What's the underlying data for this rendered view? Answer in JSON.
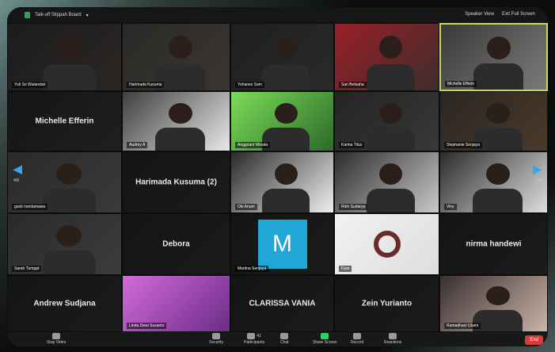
{
  "window": {
    "top_left_title": "Talk-off Slippah Board",
    "speaker_view": "Speaker View",
    "exit_full_screen": "Exit Full Screen"
  },
  "pager": {
    "left_label": "4/8",
    "right_label": "1/8"
  },
  "participants": [
    {
      "id": "tile-1",
      "name": "Yuli Sri Wulandari",
      "kind": "video"
    },
    {
      "id": "tile-2",
      "name": "Harimada Kusuma",
      "kind": "video"
    },
    {
      "id": "tile-3",
      "name": "Yohanes Sam",
      "kind": "video"
    },
    {
      "id": "tile-4",
      "name": "Sari Betsaha",
      "kind": "video"
    },
    {
      "id": "tile-5",
      "name": "Michelle Efferin",
      "kind": "video",
      "active": true
    },
    {
      "id": "tile-6",
      "name": "Michelle Efferin",
      "kind": "name"
    },
    {
      "id": "tile-7",
      "name": "Audrey A",
      "kind": "video"
    },
    {
      "id": "tile-8",
      "name": "Anggriani Winata",
      "kind": "video"
    },
    {
      "id": "tile-9",
      "name": "Karina Tilus",
      "kind": "video"
    },
    {
      "id": "tile-10",
      "name": "Stephanie Senjaya",
      "kind": "video"
    },
    {
      "id": "tile-11",
      "name": "gusti nondamawa",
      "kind": "video"
    },
    {
      "id": "tile-12",
      "name": "Harimada Kusuma (2)",
      "kind": "name"
    },
    {
      "id": "tile-13",
      "name": "Oki Anum",
      "kind": "video"
    },
    {
      "id": "tile-14",
      "name": "Ririn Sudarya",
      "kind": "video"
    },
    {
      "id": "tile-15",
      "name": "Viny",
      "kind": "video"
    },
    {
      "id": "tile-16",
      "name": "Sarah Tumppt",
      "kind": "video"
    },
    {
      "id": "tile-17",
      "name": "Debora",
      "kind": "name"
    },
    {
      "id": "tile-18",
      "name": "Martina Senjaya",
      "kind": "avatar",
      "avatar_letter": "M",
      "avatar_color": "#21a7d6"
    },
    {
      "id": "tile-19",
      "name": "Fara",
      "kind": "image"
    },
    {
      "id": "tile-20",
      "name": "nirma handewi",
      "kind": "name"
    },
    {
      "id": "tile-21",
      "name": "Andrew Sudjana",
      "kind": "name"
    },
    {
      "id": "tile-22",
      "name": "Linda Dewi Susanto",
      "kind": "image"
    },
    {
      "id": "tile-23",
      "name": "CLARISSA VANIA",
      "kind": "name"
    },
    {
      "id": "tile-24",
      "name": "Zein Yurianto",
      "kind": "name"
    },
    {
      "id": "tile-25",
      "name": "Ramadhani Utami",
      "kind": "video"
    }
  ],
  "toolbar": {
    "stop_video": "Stop Video",
    "security": "Security",
    "participants": "Participants",
    "participants_count": "41",
    "chat": "Chat",
    "share_screen": "Share Screen",
    "record": "Record",
    "reactions": "Reactions",
    "end": "End"
  },
  "colors": {
    "active_speaker_border": "#c7d85c",
    "accent_blue": "#3aa7e8",
    "share_green": "#2ccf6b",
    "end_red": "#d83b3b"
  }
}
